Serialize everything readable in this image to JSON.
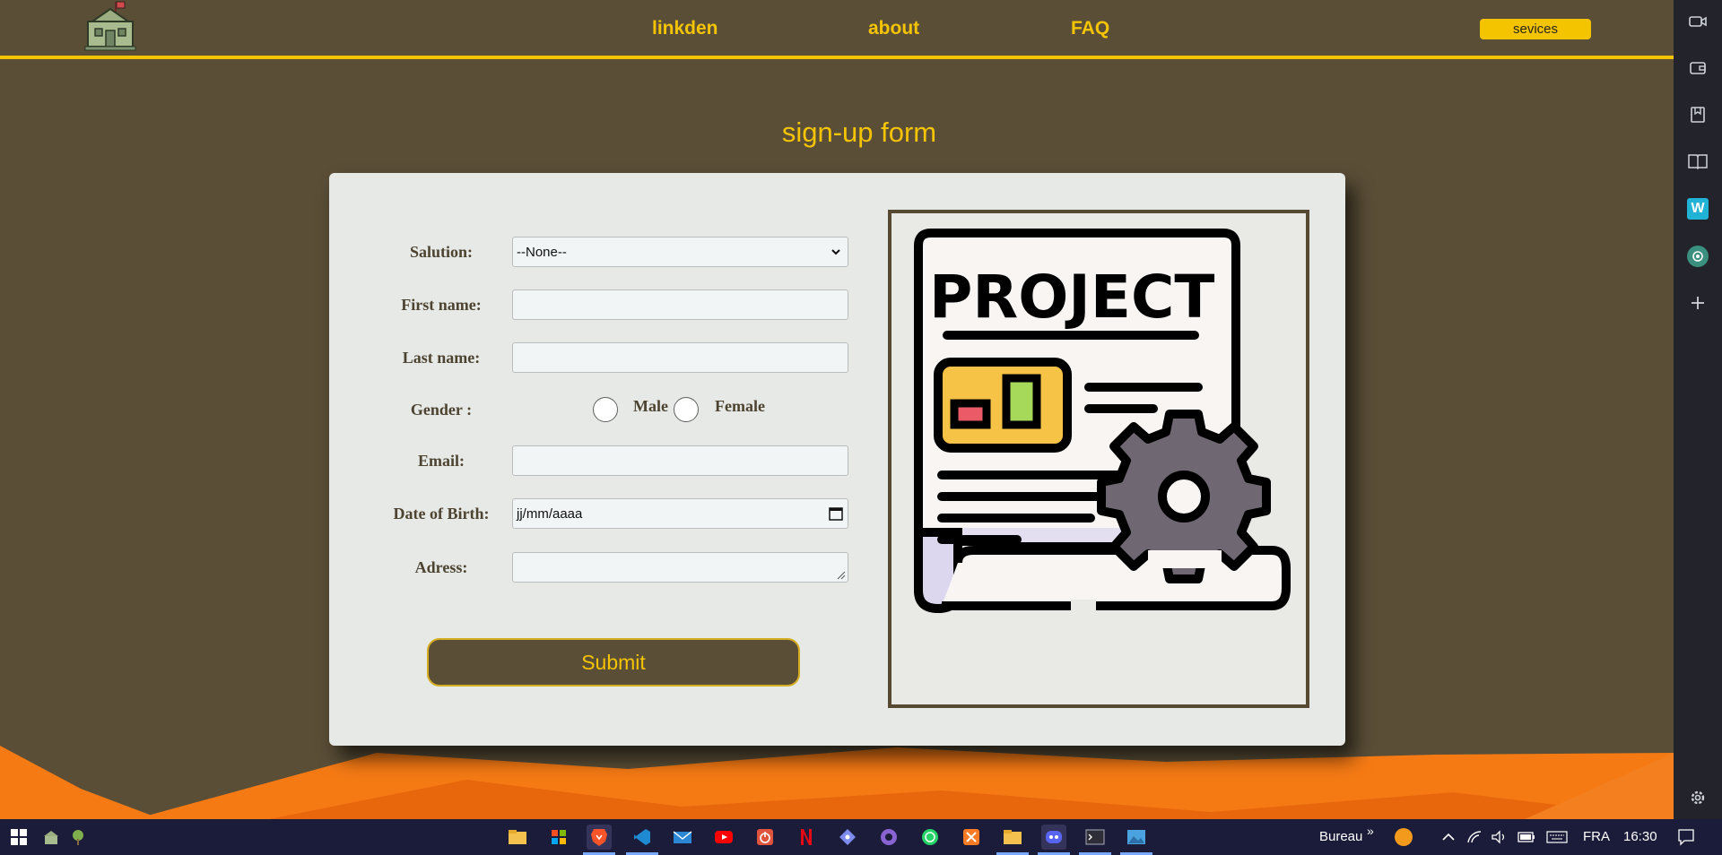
{
  "nav": {
    "links": [
      "linkden",
      "about",
      "FAQ"
    ],
    "button": "sevices"
  },
  "page_title": "sign-up form",
  "form": {
    "salutation_label": "Salution:",
    "salutation_value": "--None--",
    "first_name_label": "First name:",
    "last_name_label": "Last name:",
    "gender_label": "Gender :",
    "male_label": "Male",
    "female_label": "Female",
    "email_label": "Email:",
    "dob_label": "Date of Birth:",
    "dob_placeholder": "jj/mm/aaaa",
    "address_label": "Adress:",
    "submit_label": "Submit"
  },
  "illustration": {
    "heading": "PROJECT"
  },
  "taskbar": {
    "bureau_label": "Bureau",
    "chevron": "»",
    "language": "FRA",
    "time": "16:30"
  },
  "colors": {
    "page_bg": "#5a4e37",
    "accent_yellow": "#f5c400",
    "card_bg": "#e7e9e6",
    "orange": "#f57a14"
  }
}
